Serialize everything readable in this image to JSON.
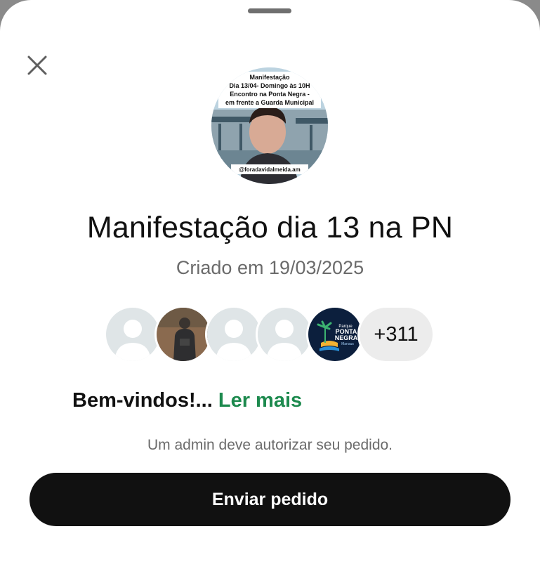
{
  "group": {
    "title": "Manifestação dia 13 na PN",
    "created": "Criado em 19/03/2025",
    "avatar_lines": [
      "Manifestação",
      "Dia 13/04- Domingo às 10H",
      "Encontro na Ponta Negra -",
      "em frente a Guarda Municipal"
    ],
    "avatar_handle": "@foradavidalmeida.am"
  },
  "members": {
    "more_count": "+311",
    "logo_lines": [
      "Parque",
      "PONTA",
      "NEGRA",
      "Manaus"
    ]
  },
  "description": {
    "text": "Bem-vindos!...",
    "read_more": "Ler mais"
  },
  "admin_note": "Um admin deve autorizar seu pedido.",
  "actions": {
    "send_request": "Enviar pedido"
  },
  "colors": {
    "accent": "#1d8a4e",
    "button_bg": "#111111",
    "muted_text": "#6b6b6b"
  }
}
